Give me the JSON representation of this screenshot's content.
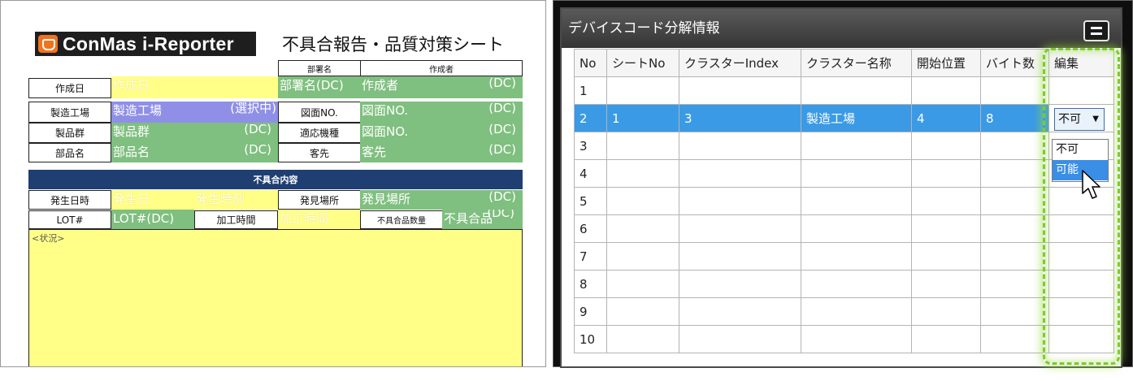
{
  "report": {
    "logo_text": "ConMas i-Reporter",
    "title": "不具合報告・品質対策シート",
    "labels": {
      "department": "部署名",
      "author": "作成者",
      "created_date": "作成日",
      "factory": "製造工場",
      "drawing_no": "図面NO.",
      "product_group": "製品群",
      "machine": "適応機種",
      "part_name": "部品名",
      "customer": "客先",
      "defect_section": "不具合内容",
      "occurrence_date": "発生日時",
      "discovery_place": "発見場所",
      "lot": "LOT#",
      "processing_time": "加工時間",
      "defect_count": "不具合品数量",
      "status": "<状況>"
    },
    "values": {
      "created_date": "作成日",
      "department": "部署名(DC)",
      "author": "作成者",
      "factory": "製造工場",
      "factory_note": "(選択中)",
      "drawing_no_1": "図面NO.",
      "product_group": "製品群",
      "drawing_no_2": "図面NO.",
      "part_name": "部品名",
      "customer": "客先",
      "occurrence_date": "発生日",
      "occurrence_time": "発生時刻",
      "discovery_place": "発見場所",
      "lot": "LOT#(DC)",
      "processing_time": "加工時間",
      "defect_count": "不具合品"
    },
    "dc_tag": "(DC)"
  },
  "panel": {
    "title": "デバイスコード分解情報",
    "columns": [
      "No",
      "シートNo",
      "クラスターIndex",
      "クラスター名称",
      "開始位置",
      "バイト数",
      "編集"
    ],
    "rows": [
      {
        "no": "1",
        "sheet": "",
        "index": "",
        "name": "",
        "start": "",
        "bytes": ""
      },
      {
        "no": "2",
        "sheet": "1",
        "index": "3",
        "name": "製造工場",
        "start": "4",
        "bytes": "8"
      },
      {
        "no": "3",
        "sheet": "",
        "index": "",
        "name": "",
        "start": "",
        "bytes": ""
      },
      {
        "no": "4",
        "sheet": "",
        "index": "",
        "name": "",
        "start": "",
        "bytes": ""
      },
      {
        "no": "5",
        "sheet": "",
        "index": "",
        "name": "",
        "start": "",
        "bytes": ""
      },
      {
        "no": "6",
        "sheet": "",
        "index": "",
        "name": "",
        "start": "",
        "bytes": ""
      },
      {
        "no": "7",
        "sheet": "",
        "index": "",
        "name": "",
        "start": "",
        "bytes": ""
      },
      {
        "no": "8",
        "sheet": "",
        "index": "",
        "name": "",
        "start": "",
        "bytes": ""
      },
      {
        "no": "9",
        "sheet": "",
        "index": "",
        "name": "",
        "start": "",
        "bytes": ""
      },
      {
        "no": "10",
        "sheet": "",
        "index": "",
        "name": "",
        "start": "",
        "bytes": ""
      }
    ],
    "edit_select_value": "不可",
    "edit_options": [
      "不可",
      "可能"
    ],
    "hovered_option": "可能"
  }
}
